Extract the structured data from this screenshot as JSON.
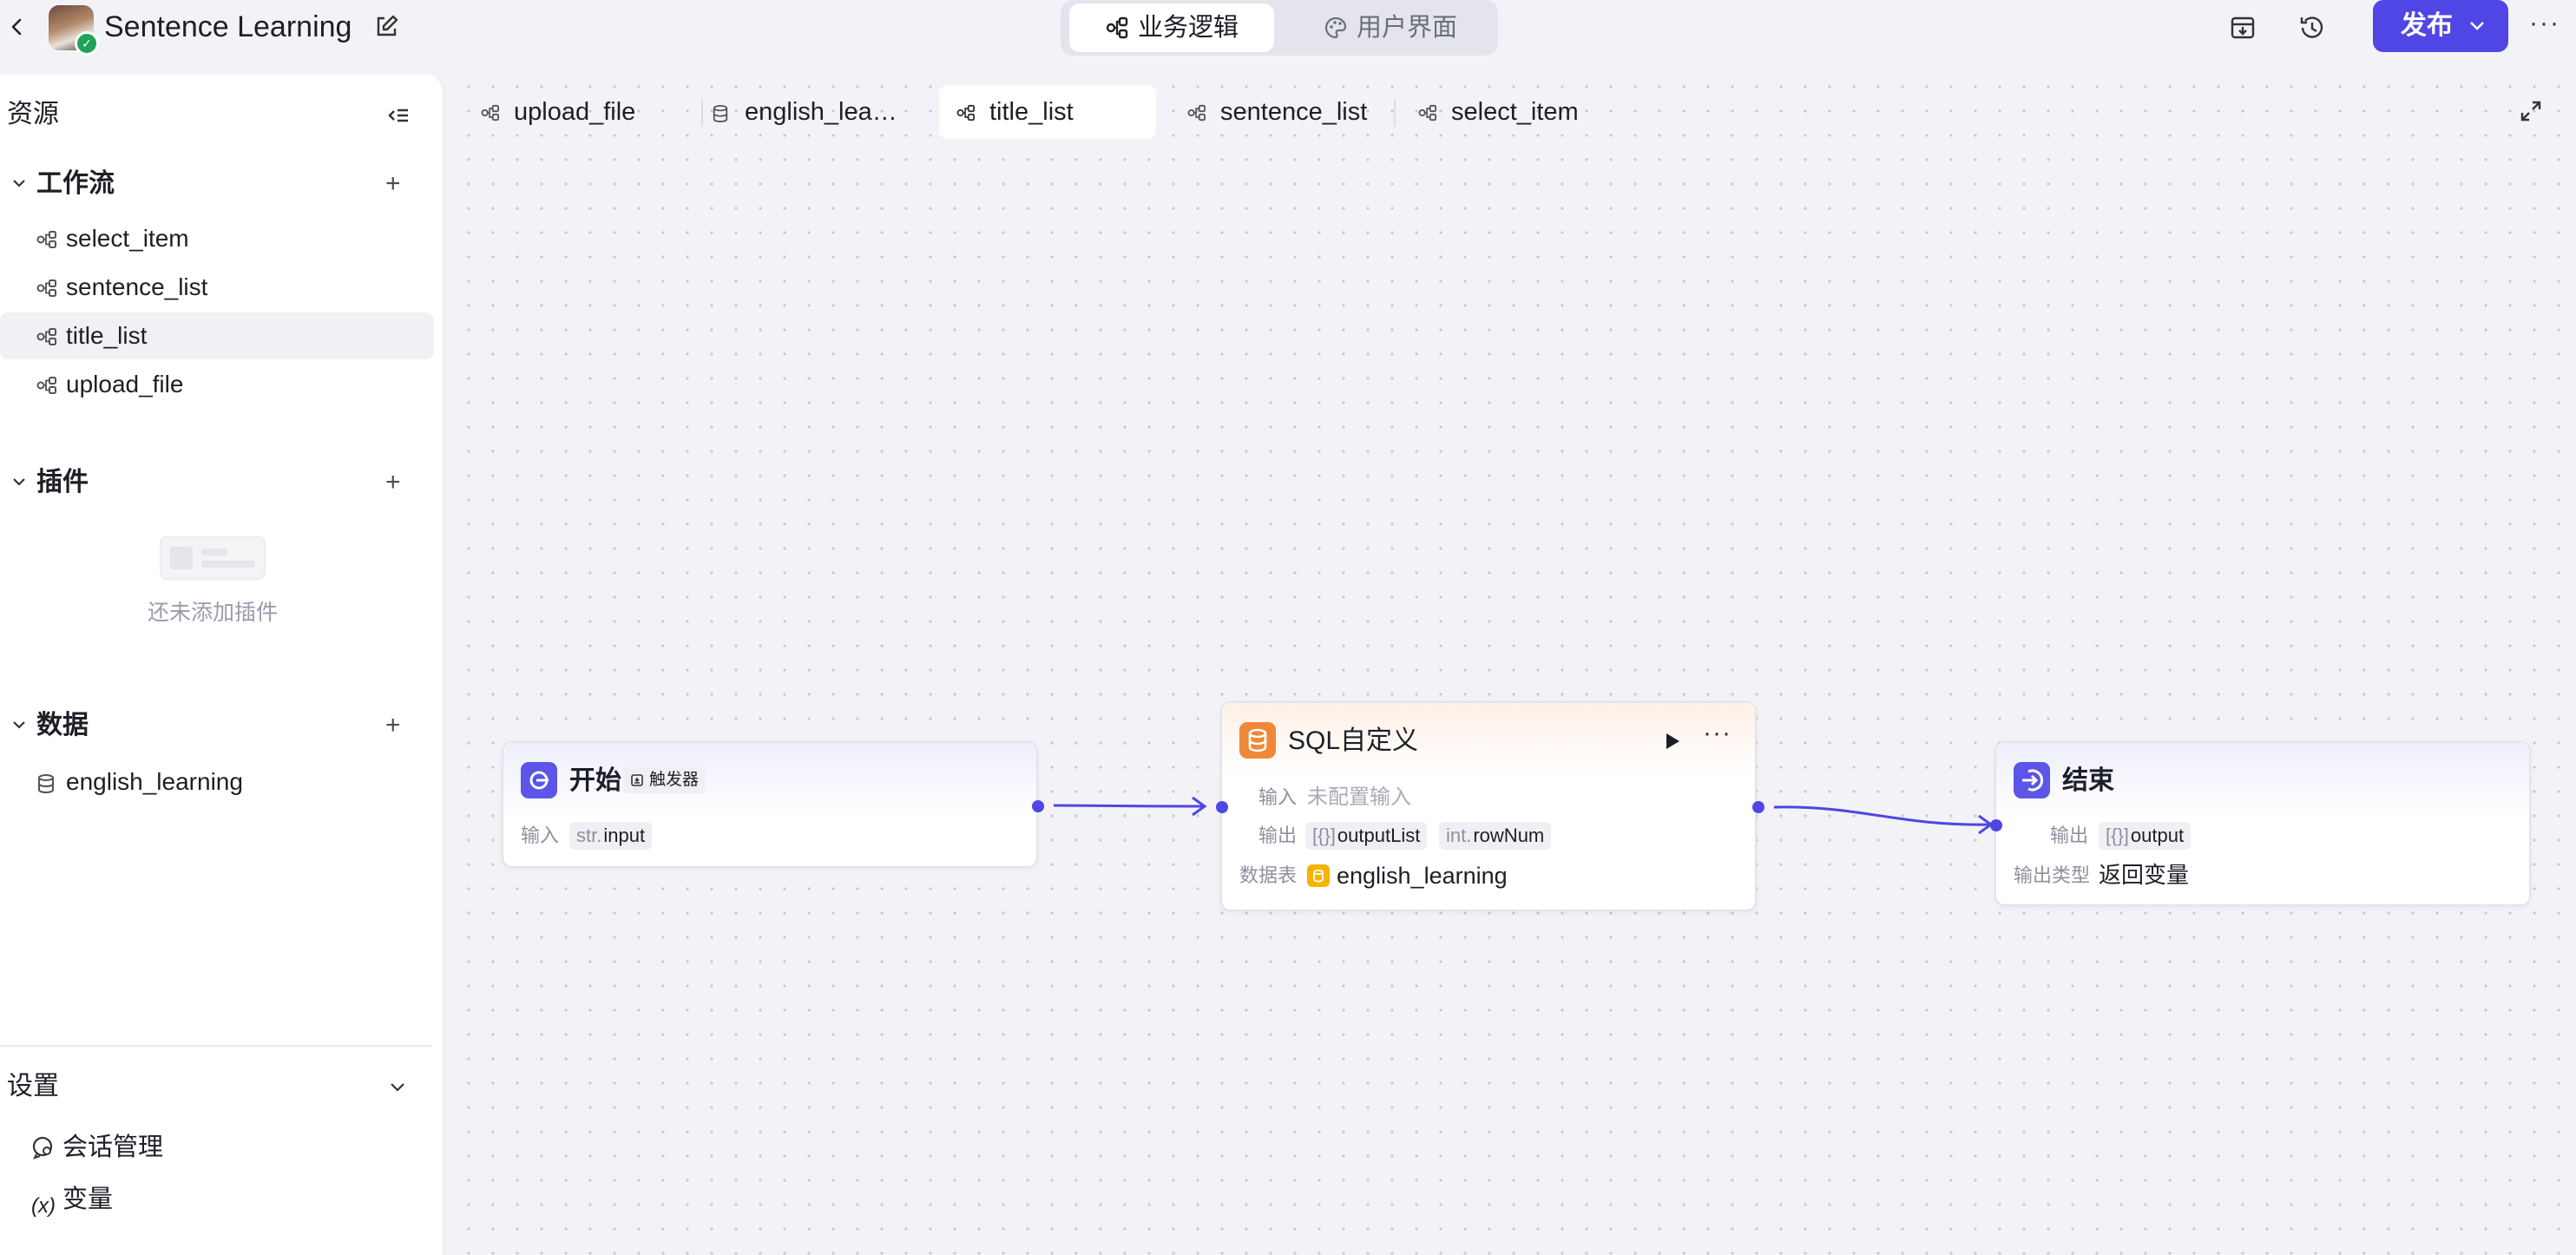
{
  "header": {
    "app_title": "Sentence Learning",
    "mode_tabs": [
      "业务逻辑",
      "用户界面"
    ],
    "publish_label": "发布",
    "more_label": "···"
  },
  "sidebar": {
    "title": "资源",
    "workflow": {
      "title": "工作流",
      "items": [
        "select_item",
        "sentence_list",
        "title_list",
        "upload_file"
      ],
      "active": "title_list"
    },
    "plugins": {
      "title": "插件",
      "empty_text": "还未添加插件"
    },
    "data": {
      "title": "数据",
      "items": [
        "english_learning"
      ]
    },
    "settings": {
      "title": "设置",
      "items": [
        {
          "icon": "conversation-icon",
          "label": "会话管理"
        },
        {
          "icon": "variable-icon",
          "icon_text": "(x)",
          "label": "变量"
        }
      ]
    }
  },
  "tabs": [
    {
      "label": "upload_file",
      "icon": "workflow-icon"
    },
    {
      "label": "english_lea…",
      "icon": "database-icon"
    },
    {
      "label": "title_list",
      "icon": "workflow-icon",
      "active": true
    },
    {
      "label": "sentence_list",
      "icon": "workflow-icon"
    },
    {
      "label": "select_item",
      "icon": "workflow-icon"
    }
  ],
  "nodes": {
    "start": {
      "title": "开始",
      "badge": "触发器",
      "input_label": "输入",
      "input_type": "str.",
      "input_name": "input"
    },
    "sql": {
      "title": "SQL自定义",
      "input_label": "输入",
      "input_value": "未配置输入",
      "output_label": "输出",
      "outputs": [
        {
          "type": "[{}]",
          "name": "outputList"
        },
        {
          "type": "int.",
          "name": "rowNum"
        }
      ],
      "table_label": "数据表",
      "table_name": "english_learning",
      "more_label": "···"
    },
    "end": {
      "title": "结束",
      "output_label": "输出",
      "output_type": "[{}]",
      "output_name": "output",
      "output_kind_label": "输出类型",
      "output_kind_value": "返回变量"
    }
  },
  "colors": {
    "primary": "#4f46e5",
    "sql_icon": "#f0883a",
    "db_chip": "#f5b400"
  }
}
